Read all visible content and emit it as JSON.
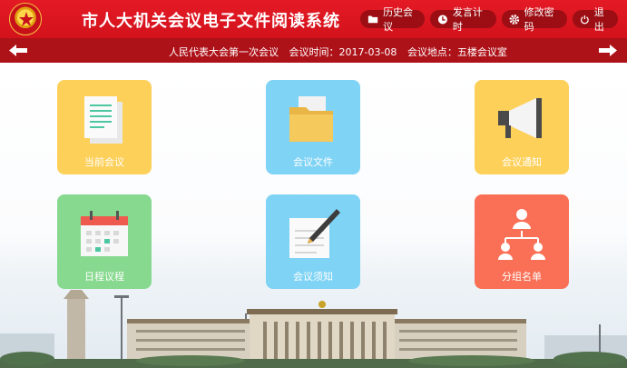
{
  "header": {
    "title": "市人大机关会议电子文件阅读系统",
    "buttons": [
      {
        "label": "历史会议",
        "icon": "folder-icon"
      },
      {
        "label": "发言计时",
        "icon": "clock-icon"
      },
      {
        "label": "修改密码",
        "icon": "gear-icon"
      },
      {
        "label": "退出",
        "icon": "power-icon"
      }
    ]
  },
  "meeting": {
    "name": "人民代表大会第一次会议",
    "time_label": "会议时间：",
    "time": "2017-03-08",
    "place_label": "会议地点：",
    "place": "五楼会议室"
  },
  "tiles": [
    {
      "label": "当前会议",
      "icon": "document-icon",
      "color": "#fdd05a"
    },
    {
      "label": "会议文件",
      "icon": "folder-icon",
      "color": "#7fd3f5"
    },
    {
      "label": "会议通知",
      "icon": "megaphone-icon",
      "color": "#fdd05a"
    },
    {
      "label": "日程议程",
      "icon": "calendar-icon",
      "color": "#86d98e"
    },
    {
      "label": "会议须知",
      "icon": "note-pen-icon",
      "color": "#7fd3f5"
    },
    {
      "label": "分组名单",
      "icon": "org-chart-icon",
      "color": "#f97056"
    }
  ],
  "colors": {
    "header": "#e41a25",
    "subbar": "#ae1219"
  }
}
